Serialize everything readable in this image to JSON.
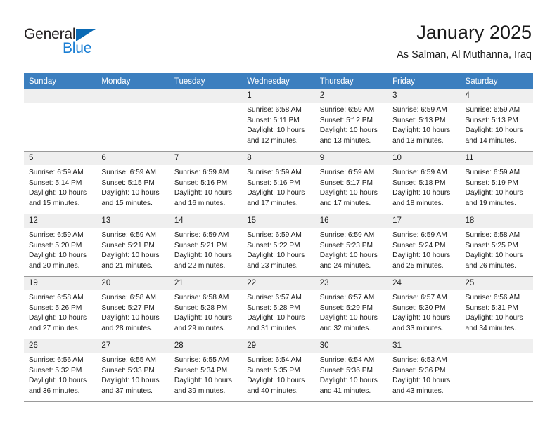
{
  "brand": {
    "name_top": "General",
    "name_bottom": "Blue"
  },
  "header": {
    "title": "January 2025",
    "subtitle": "As Salman, Al Muthanna, Iraq"
  },
  "colors": {
    "header_band": "#3c7fbf",
    "daynum_band": "#efefef",
    "brand_blue": "#1b7fd4",
    "triangle_blue": "#0a6ab5",
    "row_divider": "#9a9a9a"
  },
  "weekdays": [
    "Sunday",
    "Monday",
    "Tuesday",
    "Wednesday",
    "Thursday",
    "Friday",
    "Saturday"
  ],
  "weeks": [
    [
      {
        "day": "",
        "sunrise": "",
        "sunset": "",
        "daylight1": "",
        "daylight2": ""
      },
      {
        "day": "",
        "sunrise": "",
        "sunset": "",
        "daylight1": "",
        "daylight2": ""
      },
      {
        "day": "",
        "sunrise": "",
        "sunset": "",
        "daylight1": "",
        "daylight2": ""
      },
      {
        "day": "1",
        "sunrise": "Sunrise: 6:58 AM",
        "sunset": "Sunset: 5:11 PM",
        "daylight1": "Daylight: 10 hours",
        "daylight2": "and 12 minutes."
      },
      {
        "day": "2",
        "sunrise": "Sunrise: 6:59 AM",
        "sunset": "Sunset: 5:12 PM",
        "daylight1": "Daylight: 10 hours",
        "daylight2": "and 13 minutes."
      },
      {
        "day": "3",
        "sunrise": "Sunrise: 6:59 AM",
        "sunset": "Sunset: 5:13 PM",
        "daylight1": "Daylight: 10 hours",
        "daylight2": "and 13 minutes."
      },
      {
        "day": "4",
        "sunrise": "Sunrise: 6:59 AM",
        "sunset": "Sunset: 5:13 PM",
        "daylight1": "Daylight: 10 hours",
        "daylight2": "and 14 minutes."
      }
    ],
    [
      {
        "day": "5",
        "sunrise": "Sunrise: 6:59 AM",
        "sunset": "Sunset: 5:14 PM",
        "daylight1": "Daylight: 10 hours",
        "daylight2": "and 15 minutes."
      },
      {
        "day": "6",
        "sunrise": "Sunrise: 6:59 AM",
        "sunset": "Sunset: 5:15 PM",
        "daylight1": "Daylight: 10 hours",
        "daylight2": "and 15 minutes."
      },
      {
        "day": "7",
        "sunrise": "Sunrise: 6:59 AM",
        "sunset": "Sunset: 5:16 PM",
        "daylight1": "Daylight: 10 hours",
        "daylight2": "and 16 minutes."
      },
      {
        "day": "8",
        "sunrise": "Sunrise: 6:59 AM",
        "sunset": "Sunset: 5:16 PM",
        "daylight1": "Daylight: 10 hours",
        "daylight2": "and 17 minutes."
      },
      {
        "day": "9",
        "sunrise": "Sunrise: 6:59 AM",
        "sunset": "Sunset: 5:17 PM",
        "daylight1": "Daylight: 10 hours",
        "daylight2": "and 17 minutes."
      },
      {
        "day": "10",
        "sunrise": "Sunrise: 6:59 AM",
        "sunset": "Sunset: 5:18 PM",
        "daylight1": "Daylight: 10 hours",
        "daylight2": "and 18 minutes."
      },
      {
        "day": "11",
        "sunrise": "Sunrise: 6:59 AM",
        "sunset": "Sunset: 5:19 PM",
        "daylight1": "Daylight: 10 hours",
        "daylight2": "and 19 minutes."
      }
    ],
    [
      {
        "day": "12",
        "sunrise": "Sunrise: 6:59 AM",
        "sunset": "Sunset: 5:20 PM",
        "daylight1": "Daylight: 10 hours",
        "daylight2": "and 20 minutes."
      },
      {
        "day": "13",
        "sunrise": "Sunrise: 6:59 AM",
        "sunset": "Sunset: 5:21 PM",
        "daylight1": "Daylight: 10 hours",
        "daylight2": "and 21 minutes."
      },
      {
        "day": "14",
        "sunrise": "Sunrise: 6:59 AM",
        "sunset": "Sunset: 5:21 PM",
        "daylight1": "Daylight: 10 hours",
        "daylight2": "and 22 minutes."
      },
      {
        "day": "15",
        "sunrise": "Sunrise: 6:59 AM",
        "sunset": "Sunset: 5:22 PM",
        "daylight1": "Daylight: 10 hours",
        "daylight2": "and 23 minutes."
      },
      {
        "day": "16",
        "sunrise": "Sunrise: 6:59 AM",
        "sunset": "Sunset: 5:23 PM",
        "daylight1": "Daylight: 10 hours",
        "daylight2": "and 24 minutes."
      },
      {
        "day": "17",
        "sunrise": "Sunrise: 6:59 AM",
        "sunset": "Sunset: 5:24 PM",
        "daylight1": "Daylight: 10 hours",
        "daylight2": "and 25 minutes."
      },
      {
        "day": "18",
        "sunrise": "Sunrise: 6:58 AM",
        "sunset": "Sunset: 5:25 PM",
        "daylight1": "Daylight: 10 hours",
        "daylight2": "and 26 minutes."
      }
    ],
    [
      {
        "day": "19",
        "sunrise": "Sunrise: 6:58 AM",
        "sunset": "Sunset: 5:26 PM",
        "daylight1": "Daylight: 10 hours",
        "daylight2": "and 27 minutes."
      },
      {
        "day": "20",
        "sunrise": "Sunrise: 6:58 AM",
        "sunset": "Sunset: 5:27 PM",
        "daylight1": "Daylight: 10 hours",
        "daylight2": "and 28 minutes."
      },
      {
        "day": "21",
        "sunrise": "Sunrise: 6:58 AM",
        "sunset": "Sunset: 5:28 PM",
        "daylight1": "Daylight: 10 hours",
        "daylight2": "and 29 minutes."
      },
      {
        "day": "22",
        "sunrise": "Sunrise: 6:57 AM",
        "sunset": "Sunset: 5:28 PM",
        "daylight1": "Daylight: 10 hours",
        "daylight2": "and 31 minutes."
      },
      {
        "day": "23",
        "sunrise": "Sunrise: 6:57 AM",
        "sunset": "Sunset: 5:29 PM",
        "daylight1": "Daylight: 10 hours",
        "daylight2": "and 32 minutes."
      },
      {
        "day": "24",
        "sunrise": "Sunrise: 6:57 AM",
        "sunset": "Sunset: 5:30 PM",
        "daylight1": "Daylight: 10 hours",
        "daylight2": "and 33 minutes."
      },
      {
        "day": "25",
        "sunrise": "Sunrise: 6:56 AM",
        "sunset": "Sunset: 5:31 PM",
        "daylight1": "Daylight: 10 hours",
        "daylight2": "and 34 minutes."
      }
    ],
    [
      {
        "day": "26",
        "sunrise": "Sunrise: 6:56 AM",
        "sunset": "Sunset: 5:32 PM",
        "daylight1": "Daylight: 10 hours",
        "daylight2": "and 36 minutes."
      },
      {
        "day": "27",
        "sunrise": "Sunrise: 6:55 AM",
        "sunset": "Sunset: 5:33 PM",
        "daylight1": "Daylight: 10 hours",
        "daylight2": "and 37 minutes."
      },
      {
        "day": "28",
        "sunrise": "Sunrise: 6:55 AM",
        "sunset": "Sunset: 5:34 PM",
        "daylight1": "Daylight: 10 hours",
        "daylight2": "and 39 minutes."
      },
      {
        "day": "29",
        "sunrise": "Sunrise: 6:54 AM",
        "sunset": "Sunset: 5:35 PM",
        "daylight1": "Daylight: 10 hours",
        "daylight2": "and 40 minutes."
      },
      {
        "day": "30",
        "sunrise": "Sunrise: 6:54 AM",
        "sunset": "Sunset: 5:36 PM",
        "daylight1": "Daylight: 10 hours",
        "daylight2": "and 41 minutes."
      },
      {
        "day": "31",
        "sunrise": "Sunrise: 6:53 AM",
        "sunset": "Sunset: 5:36 PM",
        "daylight1": "Daylight: 10 hours",
        "daylight2": "and 43 minutes."
      },
      {
        "day": "",
        "sunrise": "",
        "sunset": "",
        "daylight1": "",
        "daylight2": ""
      }
    ]
  ]
}
